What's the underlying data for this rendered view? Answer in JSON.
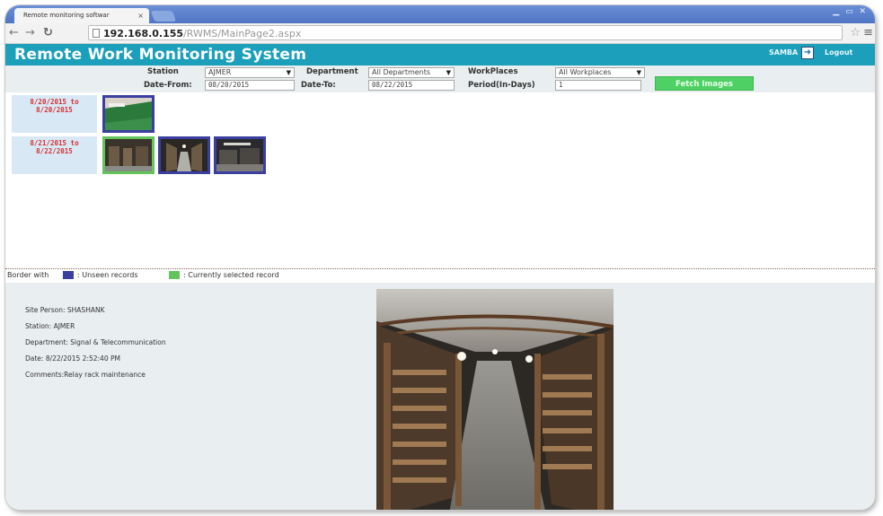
{
  "browser": {
    "tab_title": "Remote monitoring softwar",
    "tab_close": "×",
    "url_host": "192.168.0.155",
    "url_path": "/RWMS/MainPage2.aspx"
  },
  "header": {
    "title": "Remote Work Monitoring System",
    "user": "SAMBA",
    "logout": "Logout"
  },
  "filters": {
    "station_label": "Station",
    "station_value": "AJMER",
    "department_label": "Department",
    "department_value": "All Departments",
    "workplaces_label": "WorkPlaces",
    "workplaces_value": "All Workplaces",
    "date_from_label": "Date-From:",
    "date_from_value": "08/20/2015",
    "date_to_label": "Date-To:",
    "date_to_value": "08/22/2015",
    "period_label": "Period(In-Days)",
    "period_value": "1",
    "fetch_label": "Fetch Images"
  },
  "results": {
    "groups": [
      {
        "range": "8/20/2015 to 8/20/2015",
        "thumbs": [
          "unseen"
        ]
      },
      {
        "range": "8/21/2015 to 8/22/2015",
        "thumbs": [
          "selected",
          "unseen",
          "unseen"
        ]
      }
    ]
  },
  "legend": {
    "prefix": "Border with",
    "unseen_label": ": Unseen records",
    "selected_label": ": Currently selected record",
    "unseen_color": "#3b3fa0",
    "selected_color": "#62c45a"
  },
  "detail": {
    "site_person": "Site Person: SHASHANK",
    "station": "Station: AJMER",
    "department": "Department: Signal & Telecommunication",
    "date": "Date: 8/22/2015 2:52:40 PM",
    "comments": "Comments:Relay rack maintenance"
  },
  "colors": {
    "header_bg": "#1b9fba",
    "fetch_button": "#4fd064",
    "date_text": "#d23232",
    "panel_bg": "#e9eef0"
  }
}
